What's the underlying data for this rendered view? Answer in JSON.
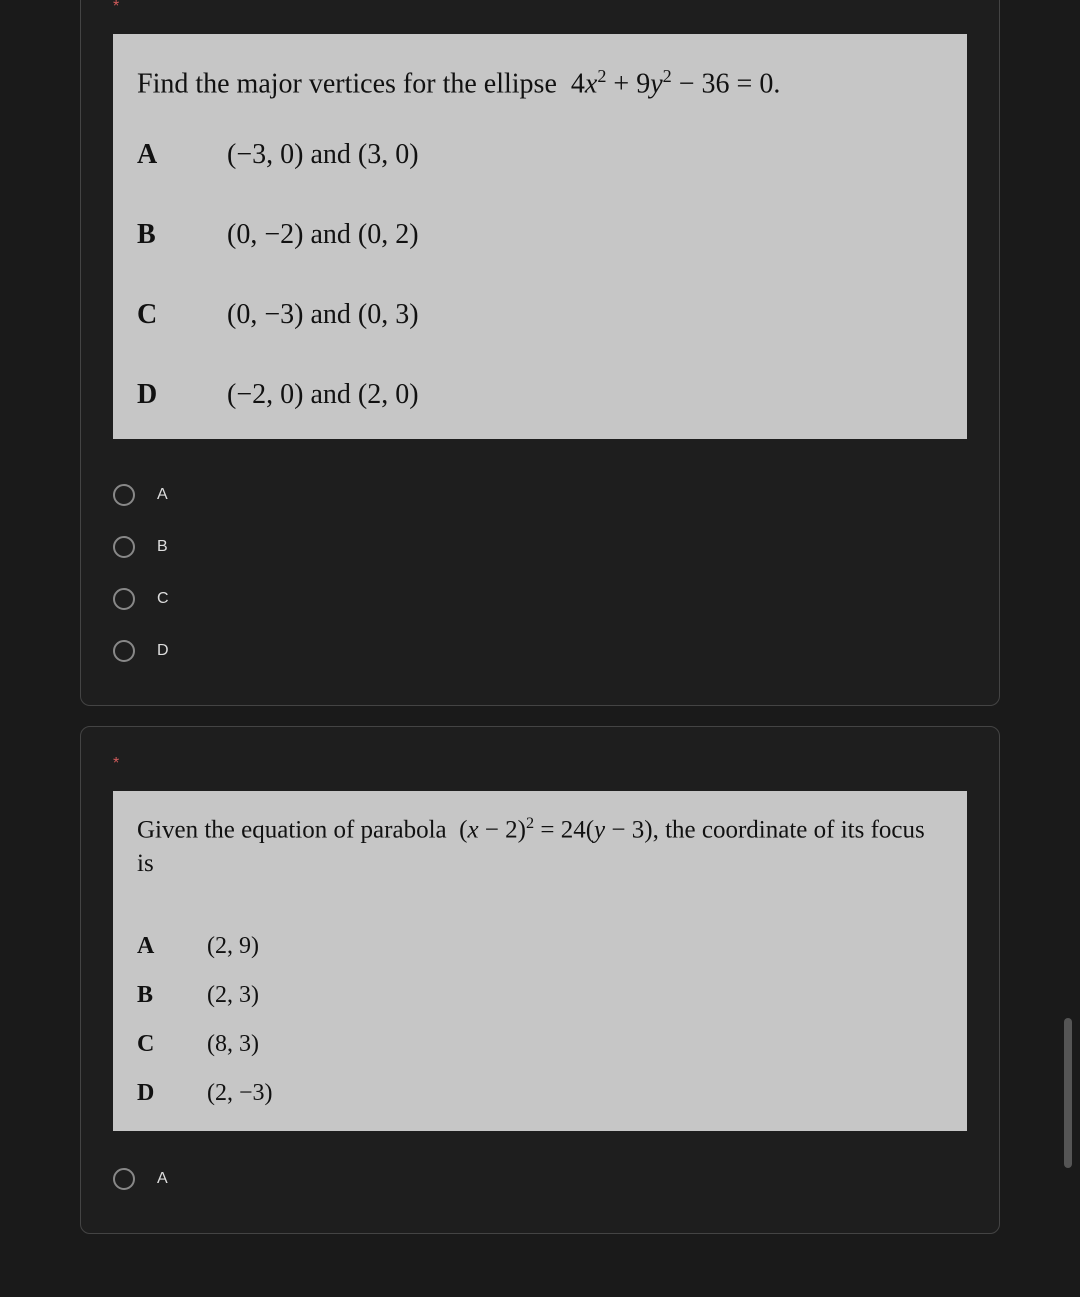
{
  "questions": [
    {
      "required_marker": "*",
      "prompt_html": "Find the major vertices for the ellipse&nbsp; 4<i>x</i><sup>2</sup> + 9<i>y</i><sup>2</sup> − 36 = 0.",
      "options": [
        {
          "letter": "A",
          "text_html": "(−3, 0) and (3, 0)"
        },
        {
          "letter": "B",
          "text_html": "(0, −2) and (0, 2)"
        },
        {
          "letter": "C",
          "text_html": "(0, −3) and (0, 3)"
        },
        {
          "letter": "D",
          "text_html": "(−2, 0) and (2, 0)"
        }
      ],
      "answers": [
        {
          "label": "A"
        },
        {
          "label": "B"
        },
        {
          "label": "C"
        },
        {
          "label": "D"
        }
      ]
    },
    {
      "required_marker": "*",
      "prompt_html": "Given the equation of parabola&nbsp; (<i>x</i> − 2)<sup>2</sup> = 24(<i>y</i> − 3), the coordinate of its focus is",
      "options": [
        {
          "letter": "A",
          "text_html": "(2, 9)"
        },
        {
          "letter": "B",
          "text_html": "(2, 3)"
        },
        {
          "letter": "C",
          "text_html": "(8, 3)"
        },
        {
          "letter": "D",
          "text_html": "(2, −3)"
        }
      ],
      "answers": [
        {
          "label": "A"
        }
      ]
    }
  ]
}
